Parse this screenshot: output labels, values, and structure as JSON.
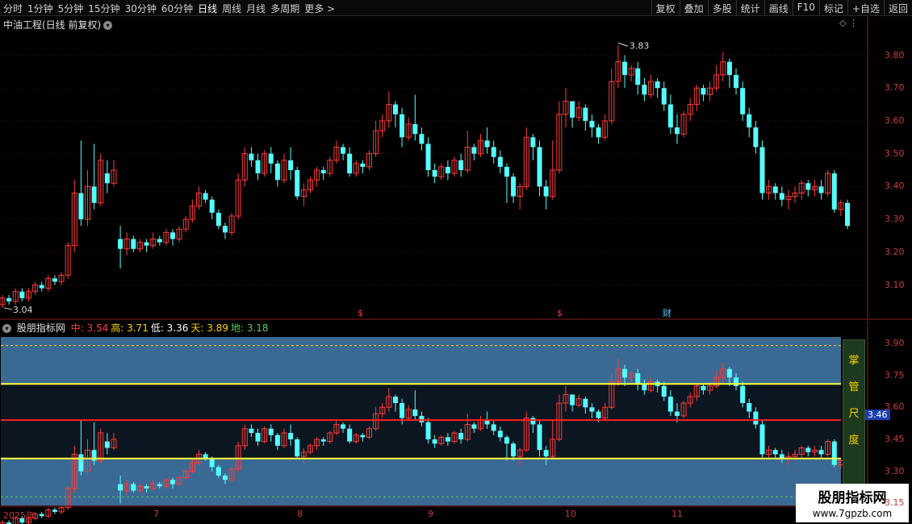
{
  "toolbar": {
    "periods": [
      "分时",
      "1分钟",
      "5分钟",
      "15分钟",
      "30分钟",
      "60分钟",
      "日线",
      "周线",
      "月线",
      "多周期",
      "更多 >"
    ],
    "active_period": "日线",
    "actions": [
      "复权",
      "叠加",
      "多股",
      "统计",
      "画线",
      "F10",
      "标记",
      "+自选",
      "返回"
    ]
  },
  "main_title": "中油工程(日线 前复权)",
  "price_axis": [
    "3.80",
    "3.70",
    "3.60",
    "3.50",
    "3.40",
    "3.30",
    "3.20",
    "3.10"
  ],
  "annotations": {
    "high": "3.83",
    "low": "3.04"
  },
  "event_markers": [
    "$",
    "$",
    "财"
  ],
  "sub_indicator": {
    "name": "股朋指标网",
    "labels": [
      {
        "k": "中:",
        "v": "3.54",
        "color": "#ff3b3b"
      },
      {
        "k": "高:",
        "v": "3.71",
        "color": "#ffd400"
      },
      {
        "k": "低:",
        "v": "3.36",
        "color": "#ffffff"
      },
      {
        "k": "天:",
        "v": "3.89",
        "color": "#ffd400"
      },
      {
        "k": "地:",
        "v": "3.18",
        "color": "#4fd14f"
      }
    ],
    "axis": [
      "3.90",
      "3.75",
      "3.60",
      "3.45",
      "3.30",
      "3.15"
    ],
    "current_price": "3.46",
    "gauge_text": [
      "掌",
      "管",
      "尺",
      "度"
    ]
  },
  "date_axis": [
    "2025年",
    "7",
    "8",
    "9",
    "10",
    "11"
  ],
  "watermark": {
    "title": "股朋指标网",
    "url": "www.7gpzb.com"
  },
  "chart_data": {
    "type": "candlestick",
    "title": "中油工程(日线 前复权)",
    "ylim": [
      3.03,
      3.87
    ],
    "candles": [
      [
        3.04,
        3.06,
        3.03,
        3.07
      ],
      [
        3.06,
        3.05,
        3.04,
        3.07
      ],
      [
        3.05,
        3.08,
        3.04,
        3.09
      ],
      [
        3.08,
        3.06,
        3.05,
        3.09
      ],
      [
        3.06,
        3.08,
        3.05,
        3.09
      ],
      [
        3.08,
        3.1,
        3.07,
        3.11
      ],
      [
        3.1,
        3.09,
        3.08,
        3.11
      ],
      [
        3.09,
        3.12,
        3.08,
        3.13
      ],
      [
        3.12,
        3.11,
        3.1,
        3.13
      ],
      [
        3.11,
        3.13,
        3.1,
        3.14
      ],
      [
        3.13,
        3.22,
        3.12,
        3.23
      ],
      [
        3.22,
        3.38,
        3.2,
        3.42
      ],
      [
        3.38,
        3.3,
        3.28,
        3.54
      ],
      [
        3.3,
        3.4,
        3.28,
        3.45
      ],
      [
        3.4,
        3.35,
        3.33,
        3.53
      ],
      [
        3.35,
        3.48,
        3.34,
        3.5
      ],
      [
        3.44,
        3.41,
        3.38,
        3.48
      ],
      [
        3.41,
        3.45,
        3.4,
        3.48
      ],
      [
        3.24,
        3.21,
        3.15,
        3.28
      ],
      [
        3.21,
        3.24,
        3.19,
        3.26
      ],
      [
        3.24,
        3.21,
        3.2,
        3.25
      ],
      [
        3.21,
        3.23,
        3.2,
        3.24
      ],
      [
        3.23,
        3.22,
        3.2,
        3.24
      ],
      [
        3.22,
        3.24,
        3.21,
        3.26
      ],
      [
        3.24,
        3.23,
        3.22,
        3.25
      ],
      [
        3.23,
        3.26,
        3.22,
        3.27
      ],
      [
        3.26,
        3.24,
        3.22,
        3.27
      ],
      [
        3.24,
        3.27,
        3.23,
        3.28
      ],
      [
        3.27,
        3.3,
        3.26,
        3.31
      ],
      [
        3.3,
        3.34,
        3.29,
        3.36
      ],
      [
        3.34,
        3.38,
        3.33,
        3.4
      ],
      [
        3.38,
        3.36,
        3.35,
        3.39
      ],
      [
        3.36,
        3.32,
        3.3,
        3.37
      ],
      [
        3.32,
        3.28,
        3.27,
        3.33
      ],
      [
        3.28,
        3.26,
        3.24,
        3.29
      ],
      [
        3.26,
        3.31,
        3.25,
        3.32
      ],
      [
        3.31,
        3.42,
        3.3,
        3.44
      ],
      [
        3.42,
        3.5,
        3.4,
        3.52
      ],
      [
        3.5,
        3.48,
        3.46,
        3.52
      ],
      [
        3.48,
        3.44,
        3.42,
        3.5
      ],
      [
        3.44,
        3.5,
        3.43,
        3.51
      ],
      [
        3.5,
        3.47,
        3.44,
        3.52
      ],
      [
        3.47,
        3.42,
        3.4,
        3.48
      ],
      [
        3.42,
        3.48,
        3.41,
        3.5
      ],
      [
        3.48,
        3.45,
        3.42,
        3.52
      ],
      [
        3.45,
        3.37,
        3.36,
        3.46
      ],
      [
        3.37,
        3.39,
        3.34,
        3.41
      ],
      [
        3.39,
        3.42,
        3.38,
        3.43
      ],
      [
        3.42,
        3.45,
        3.4,
        3.46
      ],
      [
        3.45,
        3.44,
        3.42,
        3.46
      ],
      [
        3.44,
        3.48,
        3.43,
        3.49
      ],
      [
        3.48,
        3.52,
        3.47,
        3.54
      ],
      [
        3.52,
        3.5,
        3.48,
        3.53
      ],
      [
        3.5,
        3.44,
        3.43,
        3.52
      ],
      [
        3.44,
        3.47,
        3.43,
        3.48
      ],
      [
        3.47,
        3.46,
        3.44,
        3.48
      ],
      [
        3.46,
        3.5,
        3.45,
        3.51
      ],
      [
        3.5,
        3.57,
        3.49,
        3.6
      ],
      [
        3.57,
        3.6,
        3.55,
        3.62
      ],
      [
        3.6,
        3.65,
        3.58,
        3.69
      ],
      [
        3.65,
        3.62,
        3.58,
        3.66
      ],
      [
        3.62,
        3.55,
        3.52,
        3.64
      ],
      [
        3.55,
        3.59,
        3.54,
        3.61
      ],
      [
        3.59,
        3.56,
        3.54,
        3.68
      ],
      [
        3.56,
        3.53,
        3.51,
        3.58
      ],
      [
        3.53,
        3.45,
        3.43,
        3.55
      ],
      [
        3.45,
        3.43,
        3.41,
        3.47
      ],
      [
        3.43,
        3.46,
        3.42,
        3.47
      ],
      [
        3.46,
        3.44,
        3.42,
        3.48
      ],
      [
        3.44,
        3.48,
        3.43,
        3.49
      ],
      [
        3.48,
        3.45,
        3.43,
        3.5
      ],
      [
        3.45,
        3.52,
        3.44,
        3.57
      ],
      [
        3.52,
        3.5,
        3.48,
        3.53
      ],
      [
        3.5,
        3.54,
        3.49,
        3.56
      ],
      [
        3.54,
        3.52,
        3.5,
        3.58
      ],
      [
        3.52,
        3.49,
        3.47,
        3.54
      ],
      [
        3.49,
        3.46,
        3.44,
        3.51
      ],
      [
        3.46,
        3.43,
        3.35,
        3.47
      ],
      [
        3.43,
        3.37,
        3.35,
        3.44
      ],
      [
        3.37,
        3.4,
        3.33,
        3.41
      ],
      [
        3.4,
        3.55,
        3.39,
        3.58
      ],
      [
        3.55,
        3.52,
        3.48,
        3.56
      ],
      [
        3.52,
        3.4,
        3.37,
        3.54
      ],
      [
        3.4,
        3.37,
        3.33,
        3.42
      ],
      [
        3.37,
        3.45,
        3.36,
        3.54
      ],
      [
        3.45,
        3.62,
        3.44,
        3.66
      ],
      [
        3.62,
        3.66,
        3.58,
        3.7
      ],
      [
        3.66,
        3.61,
        3.58,
        3.66
      ],
      [
        3.61,
        3.64,
        3.6,
        3.66
      ],
      [
        3.64,
        3.6,
        3.57,
        3.65
      ],
      [
        3.6,
        3.58,
        3.55,
        3.62
      ],
      [
        3.58,
        3.55,
        3.53,
        3.59
      ],
      [
        3.55,
        3.6,
        3.54,
        3.62
      ],
      [
        3.6,
        3.72,
        3.59,
        3.76
      ],
      [
        3.72,
        3.78,
        3.7,
        3.83
      ],
      [
        3.78,
        3.74,
        3.7,
        3.8
      ],
      [
        3.74,
        3.76,
        3.72,
        3.77
      ],
      [
        3.76,
        3.71,
        3.68,
        3.78
      ],
      [
        3.71,
        3.68,
        3.66,
        3.73
      ],
      [
        3.68,
        3.72,
        3.67,
        3.74
      ],
      [
        3.72,
        3.7,
        3.67,
        3.73
      ],
      [
        3.7,
        3.65,
        3.63,
        3.72
      ],
      [
        3.65,
        3.58,
        3.56,
        3.68
      ],
      [
        3.58,
        3.56,
        3.53,
        3.62
      ],
      [
        3.56,
        3.62,
        3.55,
        3.63
      ],
      [
        3.62,
        3.65,
        3.6,
        3.67
      ],
      [
        3.65,
        3.7,
        3.63,
        3.71
      ],
      [
        3.7,
        3.68,
        3.66,
        3.71
      ],
      [
        3.68,
        3.7,
        3.66,
        3.72
      ],
      [
        3.7,
        3.74,
        3.69,
        3.77
      ],
      [
        3.74,
        3.78,
        3.72,
        3.81
      ],
      [
        3.78,
        3.74,
        3.7,
        3.79
      ],
      [
        3.74,
        3.7,
        3.68,
        3.76
      ],
      [
        3.7,
        3.62,
        3.6,
        3.72
      ],
      [
        3.62,
        3.58,
        3.55,
        3.64
      ],
      [
        3.58,
        3.52,
        3.5,
        3.6
      ],
      [
        3.52,
        3.38,
        3.36,
        3.54
      ],
      [
        3.38,
        3.4,
        3.36,
        3.42
      ],
      [
        3.4,
        3.38,
        3.36,
        3.41
      ],
      [
        3.38,
        3.36,
        3.34,
        3.4
      ],
      [
        3.36,
        3.37,
        3.33,
        3.39
      ],
      [
        3.37,
        3.38,
        3.35,
        3.4
      ],
      [
        3.38,
        3.41,
        3.36,
        3.42
      ],
      [
        3.41,
        3.39,
        3.37,
        3.42
      ],
      [
        3.39,
        3.4,
        3.37,
        3.42
      ],
      [
        3.4,
        3.38,
        3.36,
        3.42
      ],
      [
        3.38,
        3.44,
        3.37,
        3.45
      ],
      [
        3.44,
        3.33,
        3.32,
        3.45
      ],
      [
        3.33,
        3.35,
        3.31,
        3.36
      ],
      [
        3.35,
        3.28,
        3.27,
        3.36
      ]
    ],
    "sub_lines": {
      "中": 3.54,
      "高": 3.71,
      "低": 3.36
    }
  }
}
